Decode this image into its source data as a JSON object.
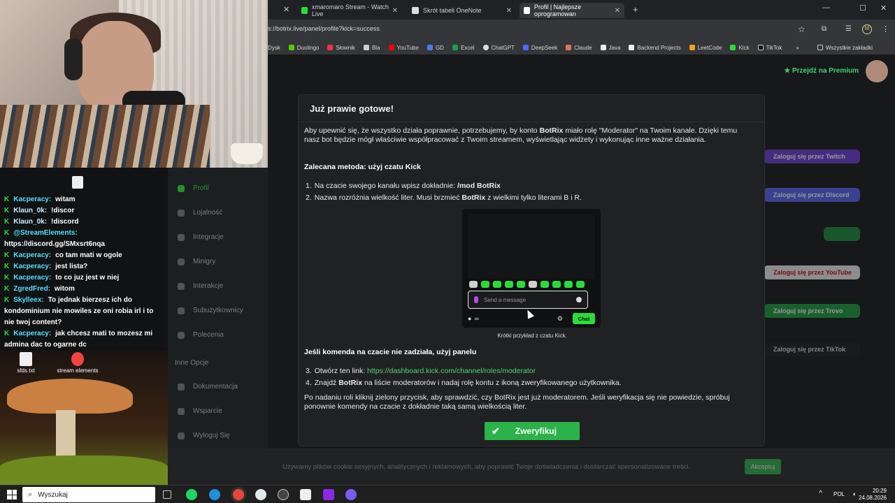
{
  "browser": {
    "tabs": [
      {
        "label": "xmaromaro Stream - Watch Live",
        "active": false
      },
      {
        "label": "Skrót tabeli OneNote",
        "active": false
      },
      {
        "label": "Profil | Najlepsze oprogramowan",
        "active": true
      }
    ],
    "url": "s://botrix.live/panel/profile?kick=success",
    "bookmarks": [
      "Dysk",
      "Duolingo",
      "Słownik",
      "Bla",
      "YouTube",
      "GD",
      "Excel",
      "ChatGPT",
      "DeepSeek",
      "Claude",
      "Java",
      "Backend Projects",
      "LeetCode",
      "Kick",
      "TikTok"
    ],
    "all_bookmarks": "Wszystkie zakładki"
  },
  "page": {
    "premium": "Przejdź na Premium",
    "login_buttons": [
      "Zaloguj się przez Twitch",
      "Zaloguj się przez Discord",
      "Zaloguj się przez YouTube",
      "Zaloguj się przez Trovo",
      "Zaloguj się przez TikTok"
    ],
    "sidebar": [
      "Profil",
      "Lojalność",
      "Integracje",
      "Minigry",
      "Interakcje",
      "Subużytkownicy",
      "Polecenia",
      "Inne Opcje",
      "Dokumentacja",
      "Wsparcie",
      "Wyloguj Się"
    ]
  },
  "chat": [
    {
      "user": "Kacperacy:",
      "msg": "witam"
    },
    {
      "user": "Klaun_0k:",
      "msg": "!discor"
    },
    {
      "user": "Klaun_0k:",
      "msg": "!discord"
    },
    {
      "user": "@StreamElements:",
      "msg": "https://discord.gg/SMxsrt6nqa"
    },
    {
      "user": "Kacperacy:",
      "msg": "co tam mati w ogole"
    },
    {
      "user": "Kacperacy:",
      "msg": "jest lista?"
    },
    {
      "user": "Kacperacy:",
      "msg": "to co juz jest w niej"
    },
    {
      "user": "ZgredFred:",
      "msg": "witom"
    },
    {
      "user": "Skylleex:",
      "msg": "To jednak bierzesz ich do kondominium nie mowiles ze oni robia irl i to nie twoj content?"
    },
    {
      "user": "Kacperacy:",
      "msg": "jak chcesz mati to mozesz mi admina dac to ogarne dc"
    }
  ],
  "desktop_icons": [
    "sfds.txt",
    "stream elements"
  ],
  "modal": {
    "title": "Już prawie gotowe!",
    "intro_1": "Aby upewnić się, że wszystko działa poprawnie, potrzebujemy, by konto ",
    "intro_bold": "BotRix",
    "intro_2": " miało rolę \"Moderator\" na Twoim kanale. Dzięki temu",
    "intro_line2": "nasz bot będzie mógł właściwie współpracować z Twoim streamem, wyświetlając widżety i wykonując inne ważne działania.",
    "section1": "Zalecana metoda: użyj czatu Kick",
    "step1_text": "Na czacie swojego kanału wpisz dokładnie: ",
    "step1_cmd": "/mod BotRix",
    "step2_a": "Nazwa rozróżnia wielkość liter. Musi brzmieć ",
    "step2_bold": "BotRix",
    "step2_b": " z wielkimi tylko literami B i R.",
    "example": {
      "placeholder": "Send a message",
      "chat_button": "Chat",
      "infinity": "∞",
      "caption": "Krótki przykład z czatu Kick."
    },
    "section2": "Jeśli komenda na czacie nie zadziała, użyj panelu",
    "step3_text": "Otwórz ten link: ",
    "step3_link": "https://dashboard.kick.com/channel/roles/moderator",
    "step4_a": "Znajdź ",
    "step4_bold": "BotRix",
    "step4_b": " na liście moderatorów i nadaj rolę kontu z ikoną zweryfikowanego użytkownika.",
    "note_line1": "Po nadaniu roli kliknij zielony przycisk, aby sprawdzić, czy BotRix jest już moderatorem. Jeśli weryfikacja się nie powiedzie, spróbuj",
    "note_line2": "ponownie komendy na czacie z dokładnie taką samą wielkością liter.",
    "verify_button": "Zweryfikuj"
  },
  "cookie": {
    "text": "Używamy plików cookie sesyjnych, analitycznych i reklamowych, aby poprawić Twoje doświadczenia i dostarczać spersonalizowane treści.",
    "button": "Akceptuj"
  },
  "taskbar": {
    "search": "Wyszukaj",
    "lang": "POL",
    "time": "20:29",
    "date": "24.08.2026"
  },
  "colors": {
    "kick_green": "#2bdb3c",
    "verify_green": "#2bb34a",
    "link_green": "#53d66a"
  }
}
